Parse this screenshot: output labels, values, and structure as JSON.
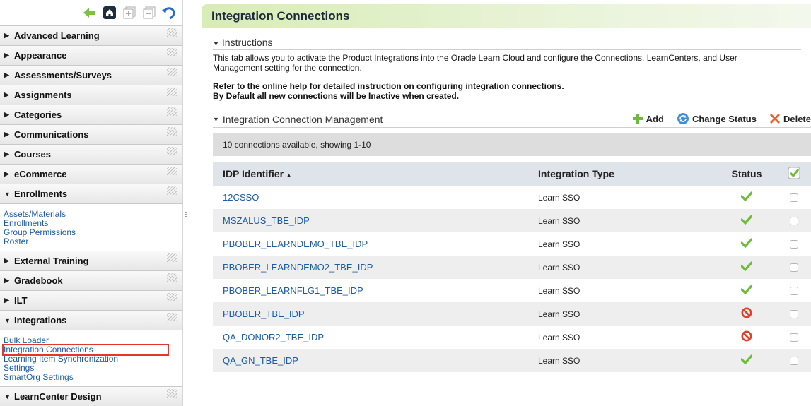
{
  "sidebar": {
    "sections": [
      {
        "label": "Advanced Learning",
        "expanded": false
      },
      {
        "label": "Appearance",
        "expanded": false
      },
      {
        "label": "Assessments/Surveys",
        "expanded": false
      },
      {
        "label": "Assignments",
        "expanded": false
      },
      {
        "label": "Categories",
        "expanded": false
      },
      {
        "label": "Communications",
        "expanded": false
      },
      {
        "label": "Courses",
        "expanded": false
      },
      {
        "label": "eCommerce",
        "expanded": false
      },
      {
        "label": "Enrollments",
        "expanded": true
      },
      {
        "label": "External Training",
        "expanded": false
      },
      {
        "label": "Gradebook",
        "expanded": false
      },
      {
        "label": "ILT",
        "expanded": false
      },
      {
        "label": "Integrations",
        "expanded": true
      },
      {
        "label": "LearnCenter Design",
        "expanded": true
      }
    ],
    "enrollments_links": [
      "Assets/Materials",
      "Enrollments",
      "Group Permissions",
      "Roster"
    ],
    "integrations_links": [
      "Bulk Loader",
      "Integration Connections",
      "Learning Item Synchronization",
      "Settings",
      "SmartOrg Settings"
    ],
    "highlighted": "Integration Connections"
  },
  "main": {
    "title": "Integration Connections",
    "instructions_heading": "Instructions",
    "instructions_text": "This tab allows you to activate the Product Integrations into the Oracle Learn Cloud and configure the Connections, LearnCenters, and User Management setting for the connection.",
    "instructions_bold_1": "Refer to the online help for detailed instruction on configuring integration connections.",
    "instructions_bold_2": "By Default all new connections will be Inactive when created.",
    "management_heading": "Integration Connection Management",
    "actions": {
      "add": "Add",
      "change_status": "Change Status",
      "delete": "Delete"
    },
    "count_text": "10 connections available, showing 1-10",
    "columns": {
      "idp": "IDP Identifier",
      "type": "Integration Type",
      "status": "Status"
    },
    "rows": [
      {
        "idp": "12CSSO",
        "type": "Learn SSO",
        "status": "active"
      },
      {
        "idp": "MSZALUS_TBE_IDP",
        "type": "Learn SSO",
        "status": "active"
      },
      {
        "idp": "PBOBER_LEARNDEMO_TBE_IDP",
        "type": "Learn SSO",
        "status": "active"
      },
      {
        "idp": "PBOBER_LEARNDEMO2_TBE_IDP",
        "type": "Learn SSO",
        "status": "active"
      },
      {
        "idp": "PBOBER_LEARNFLG1_TBE_IDP",
        "type": "Learn SSO",
        "status": "active"
      },
      {
        "idp": "PBOBER_TBE_IDP",
        "type": "Learn SSO",
        "status": "inactive"
      },
      {
        "idp": "QA_DONOR2_TBE_IDP",
        "type": "Learn SSO",
        "status": "inactive"
      },
      {
        "idp": "QA_GN_TBE_IDP",
        "type": "Learn SSO",
        "status": "active"
      }
    ]
  },
  "colors": {
    "link": "#1a5aa6",
    "active": "#6dbb3a",
    "inactive": "#d9432b",
    "highlight": "#e0392b"
  }
}
